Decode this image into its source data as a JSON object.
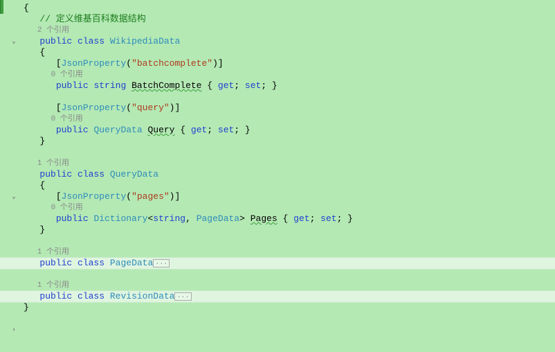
{
  "code": {
    "open_brace": "{",
    "close_brace": "}",
    "comment": "// 定义维基百科数据结构",
    "codelens_2": "2 个引用",
    "codelens_1": "1 个引用",
    "codelens_0": "0 个引用",
    "kw_public": "public",
    "kw_class": "class",
    "kw_string": "string",
    "kw_get": "get",
    "kw_set": "set",
    "type_WikipediaData": "WikipediaData",
    "type_QueryData": "QueryData",
    "type_PageData": "PageData",
    "type_RevisionData": "RevisionData",
    "type_Dictionary": "Dictionary",
    "attr_JsonProperty": "JsonProperty",
    "str_batchcomplete": "\"batchcomplete\"",
    "str_query": "\"query\"",
    "str_pages": "\"pages\"",
    "prop_BatchComplete": "BatchComplete",
    "prop_Query": "Query",
    "prop_Pages": "Pages",
    "collapsed_glyph": "...",
    "fold_expanded": "⌄",
    "fold_collapsed": "›"
  }
}
